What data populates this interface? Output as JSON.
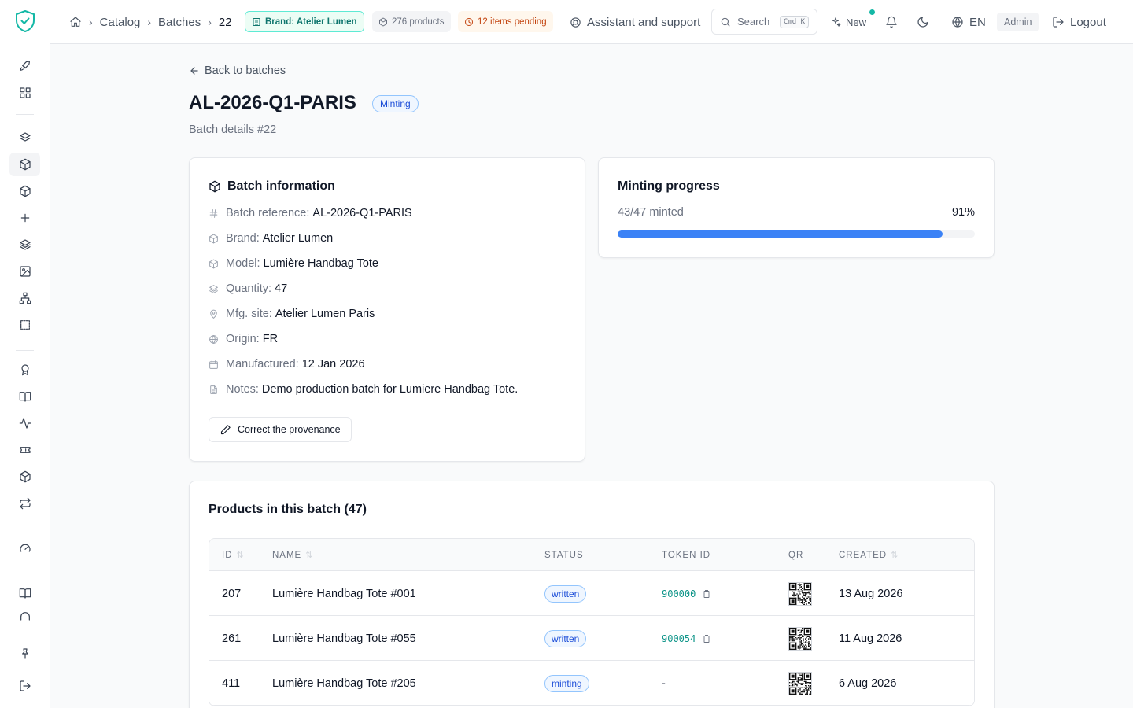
{
  "topbar": {
    "breadcrumb": [
      "Catalog",
      "Batches",
      "22"
    ],
    "pills": {
      "brand": "Brand: Atelier Lumen",
      "products": "276 products",
      "pending": "12 items pending"
    },
    "assistant": "Assistant and support",
    "search_label": "Search",
    "search_shortcut": "Cmd K",
    "new_label": "New",
    "language": "EN",
    "role": "Admin",
    "logout": "Logout"
  },
  "page": {
    "back_label": "Back to batches",
    "title": "AL-2026-Q1-PARIS",
    "status": "Minting",
    "subtitle": "Batch details #22"
  },
  "batch_info": {
    "title": "Batch information",
    "rows": [
      {
        "icon": "hash-icon",
        "label": "Batch reference:",
        "value": "AL-2026-Q1-PARIS"
      },
      {
        "icon": "box-icon",
        "label": "Brand:",
        "value": "Atelier Lumen"
      },
      {
        "icon": "box-icon",
        "label": "Model:",
        "value": "Lumière Handbag Tote"
      },
      {
        "icon": "layers-icon",
        "label": "Quantity:",
        "value": "47"
      },
      {
        "icon": "map-pin-icon",
        "label": "Mfg. site:",
        "value": "Atelier Lumen Paris"
      },
      {
        "icon": "globe-icon",
        "label": "Origin:",
        "value": "FR"
      },
      {
        "icon": "calendar-icon",
        "label": "Manufactured:",
        "value": "12 Jan 2026"
      },
      {
        "icon": "file-icon",
        "label": "Notes:",
        "value": "Demo production batch for Lumiere Handbag Tote."
      }
    ],
    "correct_button": "Correct the provenance"
  },
  "minting": {
    "title": "Minting progress",
    "count_text": "43/47 minted",
    "percent_text": "91%",
    "progress": 0.91,
    "bar_color": "#3b82f6"
  },
  "products": {
    "title": "Products in this batch (47)",
    "columns": {
      "id": "ID",
      "name": "NAME",
      "status": "STATUS",
      "token": "TOKEN ID",
      "qr": "QR",
      "created": "CREATED"
    },
    "rows": [
      {
        "id": "207",
        "name": "Lumière Handbag Tote #001",
        "status": "written",
        "token": "900000",
        "created": "13 Aug 2026"
      },
      {
        "id": "261",
        "name": "Lumière Handbag Tote #055",
        "status": "written",
        "token": "900054",
        "created": "11 Aug 2026"
      },
      {
        "id": "411",
        "name": "Lumière Handbag Tote #205",
        "status": "minting",
        "token": "-",
        "created": "6 Aug 2026"
      }
    ]
  },
  "colors": {
    "accent": "#3b82f6",
    "brand_pill_bg": "#ecfdf5",
    "brand_pill_text": "#0f766e",
    "pending_pill_bg": "#fff7ed",
    "pending_pill_text": "#c2410c",
    "token_text": "#0d9488"
  }
}
